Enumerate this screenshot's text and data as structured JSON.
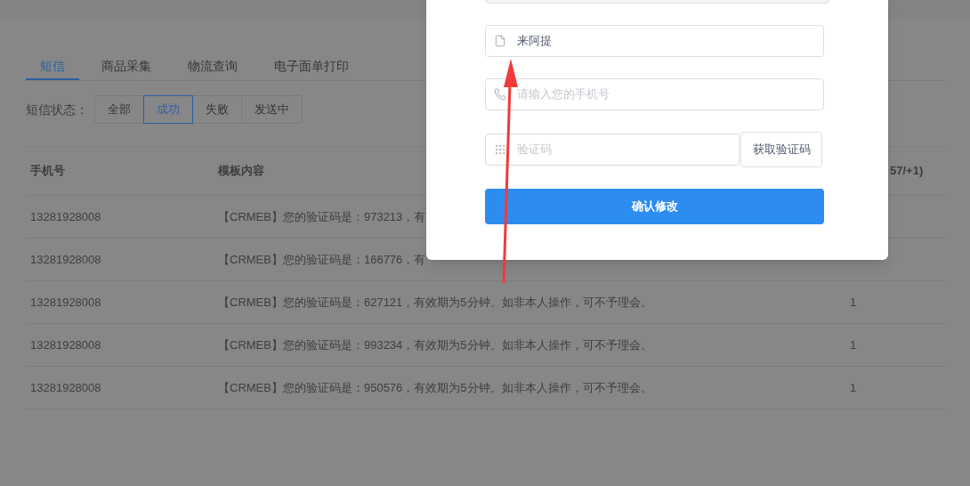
{
  "tabs": [
    {
      "label": "短信",
      "selected": true
    },
    {
      "label": "商品采集",
      "selected": false
    },
    {
      "label": "物流查询",
      "selected": false
    },
    {
      "label": "电子面单打印",
      "selected": false
    }
  ],
  "filter": {
    "label": "短信状态：",
    "options": [
      {
        "label": "全部",
        "selected": false
      },
      {
        "label": "成功",
        "selected": true
      },
      {
        "label": "失败",
        "selected": false
      },
      {
        "label": "发送中",
        "selected": false
      }
    ]
  },
  "table": {
    "columns": [
      "手机号",
      "模板内容",
      "57/+1)"
    ],
    "rows": [
      {
        "phone": "13281928008",
        "content": "【CRMEB】您的验证码是：973213，有"
      },
      {
        "phone": "13281928008",
        "content": "【CRMEB】您的验证码是：166776，有"
      },
      {
        "phone": "13281928008",
        "content": "【CRMEB】您的验证码是：627121，有效期为5分钟。如非本人操作，可不予理会。",
        "count": "1"
      },
      {
        "phone": "13281928008",
        "content": "【CRMEB】您的验证码是：993234，有效期为5分钟。如非本人操作，可不予理会。",
        "count": "1"
      },
      {
        "phone": "13281928008",
        "content": "【CRMEB】您的验证码是：950576，有效期为5分钟。如非本人操作，可不予理会。",
        "count": "1"
      }
    ]
  },
  "modal": {
    "fields": [
      {
        "kind": "partial"
      },
      {
        "kind": "text",
        "value": "来阿提"
      },
      {
        "kind": "phone",
        "placeholder": "请输入您的手机号"
      },
      {
        "kind": "code",
        "placeholder": "验证码",
        "button": "获取验证码"
      }
    ],
    "submit": "确认修改"
  }
}
